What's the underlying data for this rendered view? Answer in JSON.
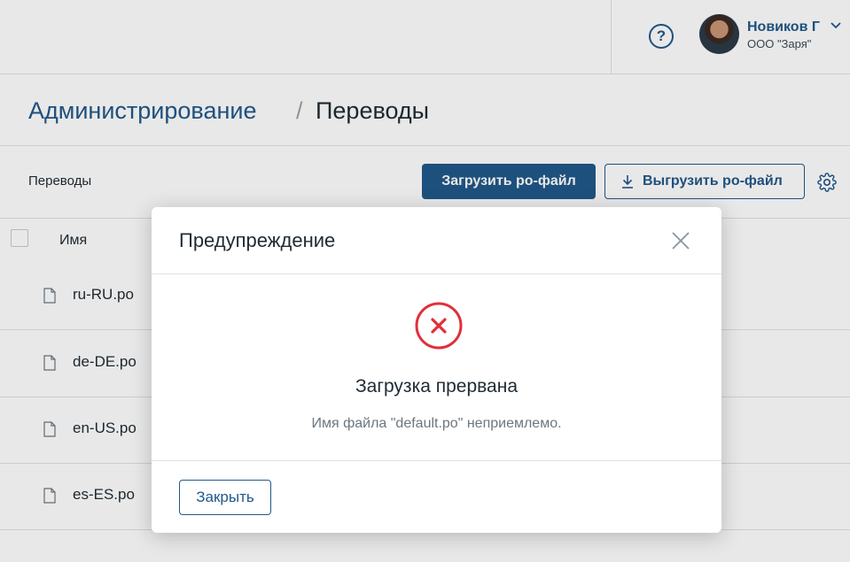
{
  "header": {
    "help_icon": "question-circle-icon",
    "user": {
      "name": "Новиков Г",
      "org": "ООО \"Заря\""
    }
  },
  "breadcrumb": {
    "parent": "Администрирование",
    "separator": "/",
    "current": "Переводы"
  },
  "toolbar": {
    "section_title": "Переводы",
    "upload_label": "Загрузить po-файл",
    "download_label": "Выгрузить po-файл",
    "settings_icon": "gear-icon"
  },
  "table": {
    "columns": [
      "Имя"
    ],
    "rows": [
      "ru-RU.po",
      "de-DE.po",
      "en-US.po",
      "es-ES.po"
    ]
  },
  "modal": {
    "title": "Предупреждение",
    "error_title": "Загрузка прервана",
    "error_message": "Имя файла \"default.po\" неприемлемо.",
    "close_label": "Закрыть"
  },
  "colors": {
    "accent": "#21588a",
    "error": "#e0303a",
    "border": "#dde2e6"
  }
}
